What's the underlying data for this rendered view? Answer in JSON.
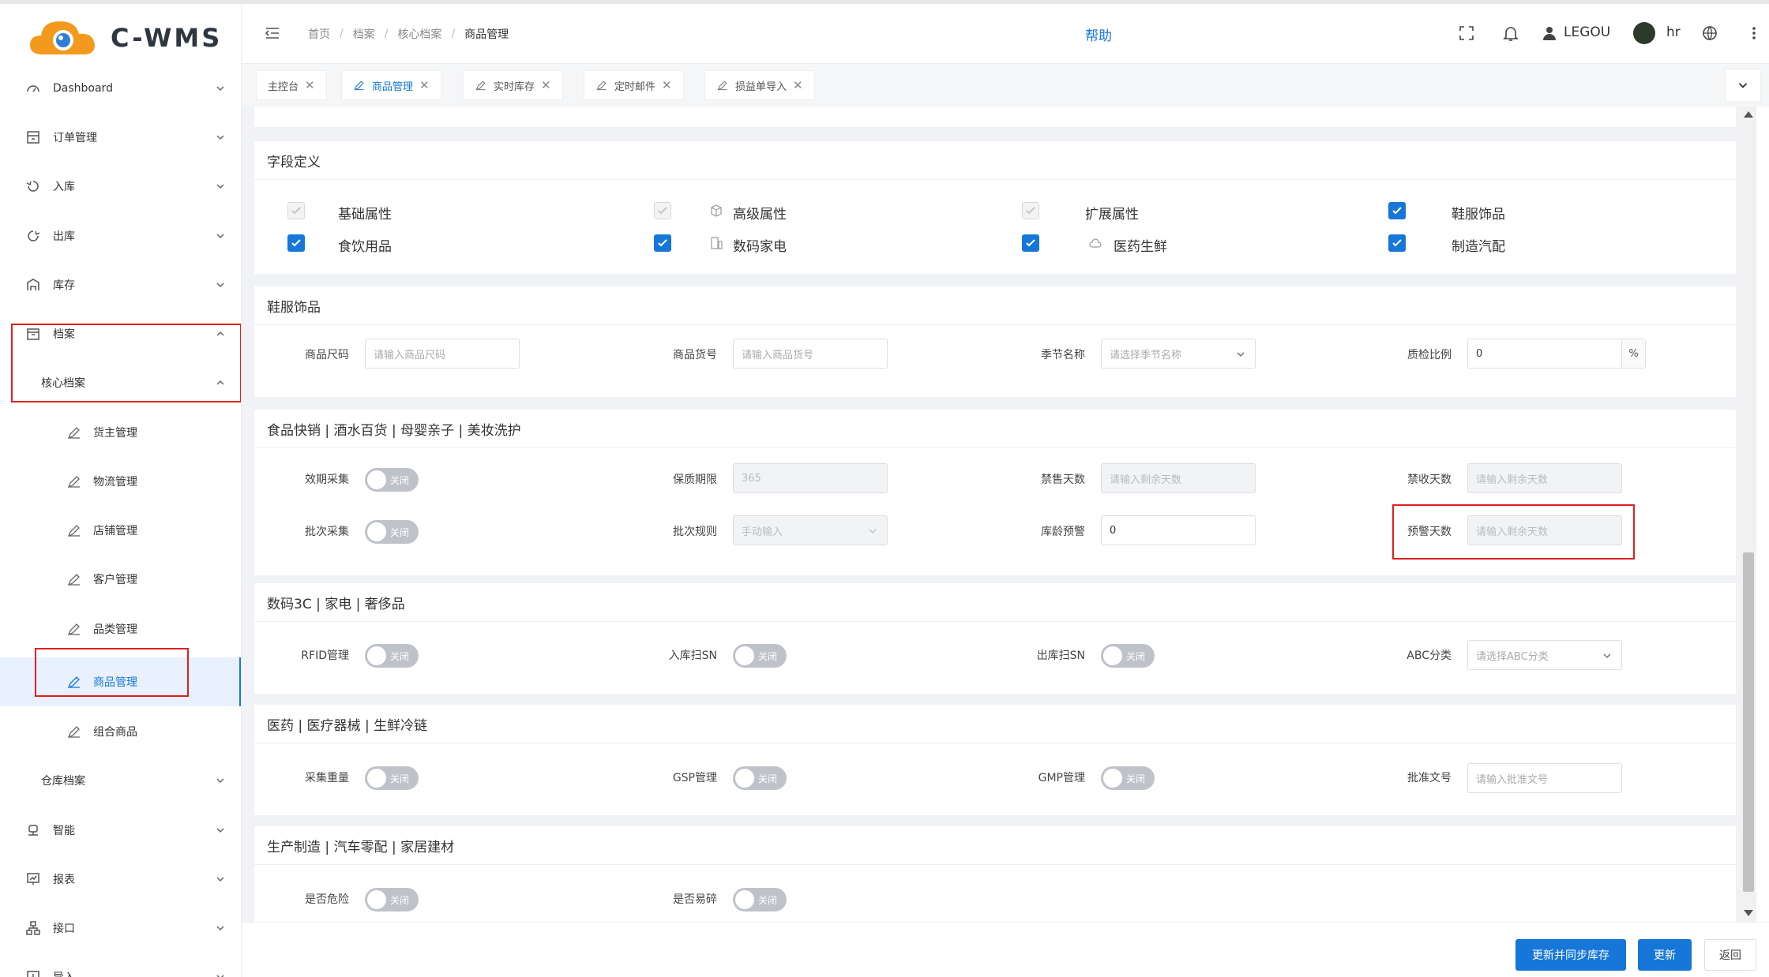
{
  "app": {
    "logo_text": "C-WMS"
  },
  "sidebar": {
    "items": [
      {
        "label": "Dashboard",
        "icon": "dashboard-icon"
      },
      {
        "label": "订单管理",
        "icon": "order-icon"
      },
      {
        "label": "入库",
        "icon": "inbound-icon"
      },
      {
        "label": "出库",
        "icon": "outbound-icon"
      },
      {
        "label": "库存",
        "icon": "inventory-icon"
      },
      {
        "label": "档案",
        "icon": "archive-icon"
      },
      {
        "label": "核心档案"
      },
      {
        "label": "货主管理",
        "icon": "edit-icon"
      },
      {
        "label": "物流管理",
        "icon": "edit-icon"
      },
      {
        "label": "店铺管理",
        "icon": "edit-icon"
      },
      {
        "label": "客户管理",
        "icon": "edit-icon"
      },
      {
        "label": "品类管理",
        "icon": "edit-icon"
      },
      {
        "label": "商品管理",
        "icon": "edit-icon"
      },
      {
        "label": "组合商品",
        "icon": "edit-icon"
      },
      {
        "label": "仓库档案"
      },
      {
        "label": "智能",
        "icon": "smart-icon"
      },
      {
        "label": "报表",
        "icon": "report-icon"
      },
      {
        "label": "接口",
        "icon": "api-icon"
      },
      {
        "label": "导入",
        "icon": "import-icon"
      }
    ]
  },
  "header": {
    "breadcrumb": [
      "首页",
      "档案",
      "核心档案",
      "商品管理"
    ],
    "help": "帮助",
    "org": "LEGOU",
    "user": "hr"
  },
  "tabs": [
    {
      "label": "主控台"
    },
    {
      "label": "商品管理"
    },
    {
      "label": "实时库存"
    },
    {
      "label": "定时邮件"
    },
    {
      "label": "损益单导入"
    }
  ],
  "fields_section": {
    "title": "字段定义",
    "options": [
      {
        "label": "基础属性",
        "checked": true,
        "disabled": true
      },
      {
        "label": "高级属性",
        "checked": true,
        "disabled": true
      },
      {
        "label": "扩展属性",
        "checked": true,
        "disabled": true
      },
      {
        "label": "鞋服饰品",
        "checked": true
      },
      {
        "label": "食饮用品",
        "checked": true
      },
      {
        "label": "数码家电",
        "checked": true
      },
      {
        "label": "医药生鲜",
        "checked": true
      },
      {
        "label": "制造汽配",
        "checked": true
      }
    ]
  },
  "apparel": {
    "title": "鞋服饰品",
    "size_label": "商品尺码",
    "size_ph": "请输入商品尺码",
    "code_label": "商品货号",
    "code_ph": "请输入商品货号",
    "season_label": "季节名称",
    "season_ph": "请选择季节名称",
    "qc_label": "质检比例",
    "qc_value": "0",
    "qc_unit": "%"
  },
  "food": {
    "title": "食品快销 | 酒水百货 | 母婴亲子 | 美妆洗护",
    "expiry_label": "效期采集",
    "expiry_state": "关闭",
    "shelf_label": "保质期限",
    "shelf_value": "365",
    "nosell_label": "禁售天数",
    "nosell_ph": "请输入剩余天数",
    "noreceive_label": "禁收天数",
    "noreceive_ph": "请输入剩余天数",
    "batch_label": "批次采集",
    "batch_state": "关闭",
    "rule_label": "批次规则",
    "rule_value": "手动输入",
    "age_label": "库龄预警",
    "age_value": "0",
    "warn_label": "预警天数",
    "warn_ph": "请输入剩余天数"
  },
  "digital": {
    "title": "数码3C | 家电 | 奢侈品",
    "rfid_label": "RFID管理",
    "rfid_state": "关闭",
    "insn_label": "入库扫SN",
    "insn_state": "关闭",
    "outsn_label": "出库扫SN",
    "outsn_state": "关闭",
    "abc_label": "ABC分类",
    "abc_ph": "请选择ABC分类"
  },
  "medical": {
    "title": "医药 | 医疗器械 | 生鲜冷链",
    "weight_label": "采集重量",
    "weight_state": "关闭",
    "gsp_label": "GSP管理",
    "gsp_state": "关闭",
    "gmp_label": "GMP管理",
    "gmp_state": "关闭",
    "approval_label": "批准文号",
    "approval_ph": "请输入批准文号"
  },
  "manufacturing": {
    "title": "生产制造 | 汽车零配 | 家居建材",
    "danger_label": "是否危险",
    "danger_state": "关闭",
    "fragile_label": "是否易碎",
    "fragile_state": "关闭"
  },
  "footer": {
    "sync_button": "更新并同步库存",
    "update_button": "更新",
    "back_button": "返回"
  },
  "colors": {
    "accent": "#1677d9",
    "highlight": "#e02020"
  }
}
